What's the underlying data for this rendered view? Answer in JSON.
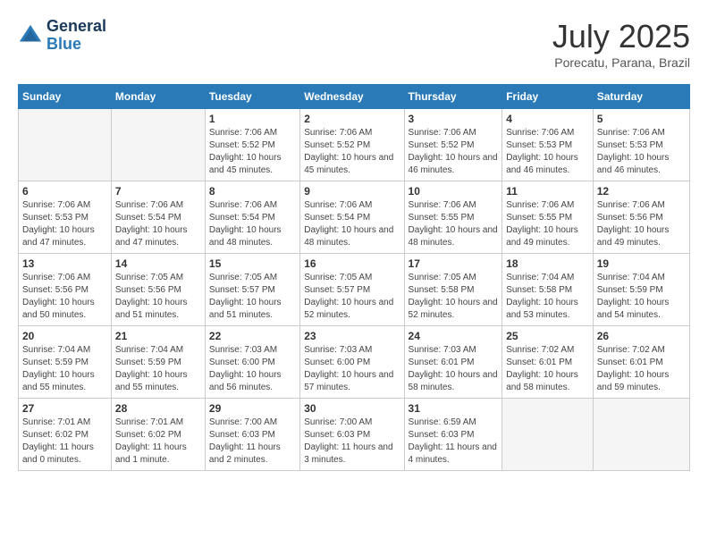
{
  "header": {
    "logo_general": "General",
    "logo_blue": "Blue",
    "month_year": "July 2025",
    "location": "Porecatu, Parana, Brazil"
  },
  "weekdays": [
    "Sunday",
    "Monday",
    "Tuesday",
    "Wednesday",
    "Thursday",
    "Friday",
    "Saturday"
  ],
  "weeks": [
    [
      {
        "day": "",
        "empty": true
      },
      {
        "day": "",
        "empty": true
      },
      {
        "day": "1",
        "sunrise": "Sunrise: 7:06 AM",
        "sunset": "Sunset: 5:52 PM",
        "daylight": "Daylight: 10 hours and 45 minutes."
      },
      {
        "day": "2",
        "sunrise": "Sunrise: 7:06 AM",
        "sunset": "Sunset: 5:52 PM",
        "daylight": "Daylight: 10 hours and 45 minutes."
      },
      {
        "day": "3",
        "sunrise": "Sunrise: 7:06 AM",
        "sunset": "Sunset: 5:52 PM",
        "daylight": "Daylight: 10 hours and 46 minutes."
      },
      {
        "day": "4",
        "sunrise": "Sunrise: 7:06 AM",
        "sunset": "Sunset: 5:53 PM",
        "daylight": "Daylight: 10 hours and 46 minutes."
      },
      {
        "day": "5",
        "sunrise": "Sunrise: 7:06 AM",
        "sunset": "Sunset: 5:53 PM",
        "daylight": "Daylight: 10 hours and 46 minutes."
      }
    ],
    [
      {
        "day": "6",
        "sunrise": "Sunrise: 7:06 AM",
        "sunset": "Sunset: 5:53 PM",
        "daylight": "Daylight: 10 hours and 47 minutes."
      },
      {
        "day": "7",
        "sunrise": "Sunrise: 7:06 AM",
        "sunset": "Sunset: 5:54 PM",
        "daylight": "Daylight: 10 hours and 47 minutes."
      },
      {
        "day": "8",
        "sunrise": "Sunrise: 7:06 AM",
        "sunset": "Sunset: 5:54 PM",
        "daylight": "Daylight: 10 hours and 48 minutes."
      },
      {
        "day": "9",
        "sunrise": "Sunrise: 7:06 AM",
        "sunset": "Sunset: 5:54 PM",
        "daylight": "Daylight: 10 hours and 48 minutes."
      },
      {
        "day": "10",
        "sunrise": "Sunrise: 7:06 AM",
        "sunset": "Sunset: 5:55 PM",
        "daylight": "Daylight: 10 hours and 48 minutes."
      },
      {
        "day": "11",
        "sunrise": "Sunrise: 7:06 AM",
        "sunset": "Sunset: 5:55 PM",
        "daylight": "Daylight: 10 hours and 49 minutes."
      },
      {
        "day": "12",
        "sunrise": "Sunrise: 7:06 AM",
        "sunset": "Sunset: 5:56 PM",
        "daylight": "Daylight: 10 hours and 49 minutes."
      }
    ],
    [
      {
        "day": "13",
        "sunrise": "Sunrise: 7:06 AM",
        "sunset": "Sunset: 5:56 PM",
        "daylight": "Daylight: 10 hours and 50 minutes."
      },
      {
        "day": "14",
        "sunrise": "Sunrise: 7:05 AM",
        "sunset": "Sunset: 5:56 PM",
        "daylight": "Daylight: 10 hours and 51 minutes."
      },
      {
        "day": "15",
        "sunrise": "Sunrise: 7:05 AM",
        "sunset": "Sunset: 5:57 PM",
        "daylight": "Daylight: 10 hours and 51 minutes."
      },
      {
        "day": "16",
        "sunrise": "Sunrise: 7:05 AM",
        "sunset": "Sunset: 5:57 PM",
        "daylight": "Daylight: 10 hours and 52 minutes."
      },
      {
        "day": "17",
        "sunrise": "Sunrise: 7:05 AM",
        "sunset": "Sunset: 5:58 PM",
        "daylight": "Daylight: 10 hours and 52 minutes."
      },
      {
        "day": "18",
        "sunrise": "Sunrise: 7:04 AM",
        "sunset": "Sunset: 5:58 PM",
        "daylight": "Daylight: 10 hours and 53 minutes."
      },
      {
        "day": "19",
        "sunrise": "Sunrise: 7:04 AM",
        "sunset": "Sunset: 5:59 PM",
        "daylight": "Daylight: 10 hours and 54 minutes."
      }
    ],
    [
      {
        "day": "20",
        "sunrise": "Sunrise: 7:04 AM",
        "sunset": "Sunset: 5:59 PM",
        "daylight": "Daylight: 10 hours and 55 minutes."
      },
      {
        "day": "21",
        "sunrise": "Sunrise: 7:04 AM",
        "sunset": "Sunset: 5:59 PM",
        "daylight": "Daylight: 10 hours and 55 minutes."
      },
      {
        "day": "22",
        "sunrise": "Sunrise: 7:03 AM",
        "sunset": "Sunset: 6:00 PM",
        "daylight": "Daylight: 10 hours and 56 minutes."
      },
      {
        "day": "23",
        "sunrise": "Sunrise: 7:03 AM",
        "sunset": "Sunset: 6:00 PM",
        "daylight": "Daylight: 10 hours and 57 minutes."
      },
      {
        "day": "24",
        "sunrise": "Sunrise: 7:03 AM",
        "sunset": "Sunset: 6:01 PM",
        "daylight": "Daylight: 10 hours and 58 minutes."
      },
      {
        "day": "25",
        "sunrise": "Sunrise: 7:02 AM",
        "sunset": "Sunset: 6:01 PM",
        "daylight": "Daylight: 10 hours and 58 minutes."
      },
      {
        "day": "26",
        "sunrise": "Sunrise: 7:02 AM",
        "sunset": "Sunset: 6:01 PM",
        "daylight": "Daylight: 10 hours and 59 minutes."
      }
    ],
    [
      {
        "day": "27",
        "sunrise": "Sunrise: 7:01 AM",
        "sunset": "Sunset: 6:02 PM",
        "daylight": "Daylight: 11 hours and 0 minutes."
      },
      {
        "day": "28",
        "sunrise": "Sunrise: 7:01 AM",
        "sunset": "Sunset: 6:02 PM",
        "daylight": "Daylight: 11 hours and 1 minute."
      },
      {
        "day": "29",
        "sunrise": "Sunrise: 7:00 AM",
        "sunset": "Sunset: 6:03 PM",
        "daylight": "Daylight: 11 hours and 2 minutes."
      },
      {
        "day": "30",
        "sunrise": "Sunrise: 7:00 AM",
        "sunset": "Sunset: 6:03 PM",
        "daylight": "Daylight: 11 hours and 3 minutes."
      },
      {
        "day": "31",
        "sunrise": "Sunrise: 6:59 AM",
        "sunset": "Sunset: 6:03 PM",
        "daylight": "Daylight: 11 hours and 4 minutes."
      },
      {
        "day": "",
        "empty": true
      },
      {
        "day": "",
        "empty": true
      }
    ]
  ]
}
